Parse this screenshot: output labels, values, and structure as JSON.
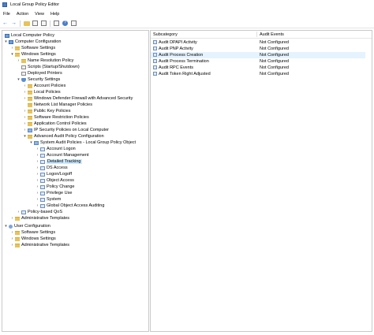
{
  "window": {
    "title": "Local Group Policy Editor"
  },
  "menu": [
    "File",
    "Action",
    "View",
    "Help"
  ],
  "tree": {
    "root": "Local Computer Policy",
    "computer_config": "Computer Configuration",
    "software_settings": "Software Settings",
    "windows_settings": "Windows Settings",
    "name_resolution": "Name Resolution Policy",
    "scripts": "Scripts (Startup/Shutdown)",
    "deployed_printers": "Deployed Printers",
    "security_settings": "Security Settings",
    "account_policies": "Account Policies",
    "local_policies": "Local Policies",
    "firewall": "Windows Defender Firewall with Advanced Security",
    "network_list": "Network List Manager Policies",
    "public_key": "Public Key Policies",
    "software_restriction": "Software Restriction Policies",
    "app_control": "Application Control Policies",
    "ip_security": "IP Security Policies on Local Computer",
    "advanced_audit": "Advanced Audit Policy Configuration",
    "system_audit": "System Audit Policies - Local Group Policy Object",
    "account_logon": "Account Logon",
    "account_management": "Account Management",
    "detailed_tracking": "Detailed Tracking",
    "ds_access": "DS Access",
    "logon_logoff": "Logon/Logoff",
    "object_access": "Object Access",
    "policy_change": "Policy Change",
    "privilege_use": "Privilege Use",
    "system": "System",
    "global_object": "Global Object Access Auditing",
    "qos": "Policy-based QoS",
    "admin_templates": "Administrative Templates",
    "user_config": "User Configuration",
    "user_software": "Software Settings",
    "user_windows": "Windows Settings",
    "user_admin": "Administrative Templates"
  },
  "list": {
    "headers": {
      "subcategory": "Subcategory",
      "audit_events": "Audit Events"
    },
    "rows": [
      {
        "name": "Audit DPAPI Activity",
        "value": "Not Configured"
      },
      {
        "name": "Audit PNP Activity",
        "value": "Not Configured"
      },
      {
        "name": "Audit Process Creation",
        "value": "Not Configured"
      },
      {
        "name": "Audit Process Termination",
        "value": "Not Configured"
      },
      {
        "name": "Audit RPC Events",
        "value": "Not Configured"
      },
      {
        "name": "Audit Token Right Adjusted",
        "value": "Not Configured"
      }
    ]
  },
  "colors": {
    "selection": "#cce8ff",
    "row_highlight": "#e5f3ff",
    "folder": "#e8c25a",
    "accent": "#2a6fcf"
  },
  "icons": [
    "back-arrow-icon",
    "forward-arrow-icon",
    "folder-icon",
    "properties-icon",
    "help-icon",
    "export-icon",
    "view-icon"
  ]
}
